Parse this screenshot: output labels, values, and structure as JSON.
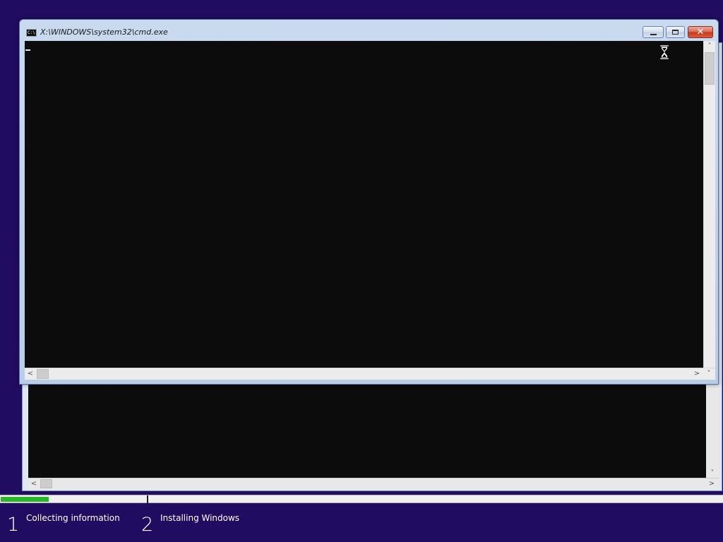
{
  "window": {
    "title": "X:\\WINDOWS\\system32\\cmd.exe",
    "icon": "cmd-icon",
    "icon_text": "C:\\",
    "minimize_icon": "minimize-icon",
    "maximize_icon": "restore-icon",
    "close_glyph": "✕"
  },
  "console": {
    "background": "#0c0c0c",
    "cursor_color": "#e8e8e8",
    "busy_cursor": "hourglass-icon"
  },
  "scrollbars": {
    "up_arrow": "˄",
    "down_arrow": "˅",
    "left_arrow": "<",
    "right_arrow": ">"
  },
  "setup": {
    "progress_fraction": 0.066,
    "progress_color": "#2bb52b",
    "steps": [
      {
        "number": "1",
        "label": "Collecting information"
      },
      {
        "number": "2",
        "label": "Installing Windows"
      }
    ]
  }
}
